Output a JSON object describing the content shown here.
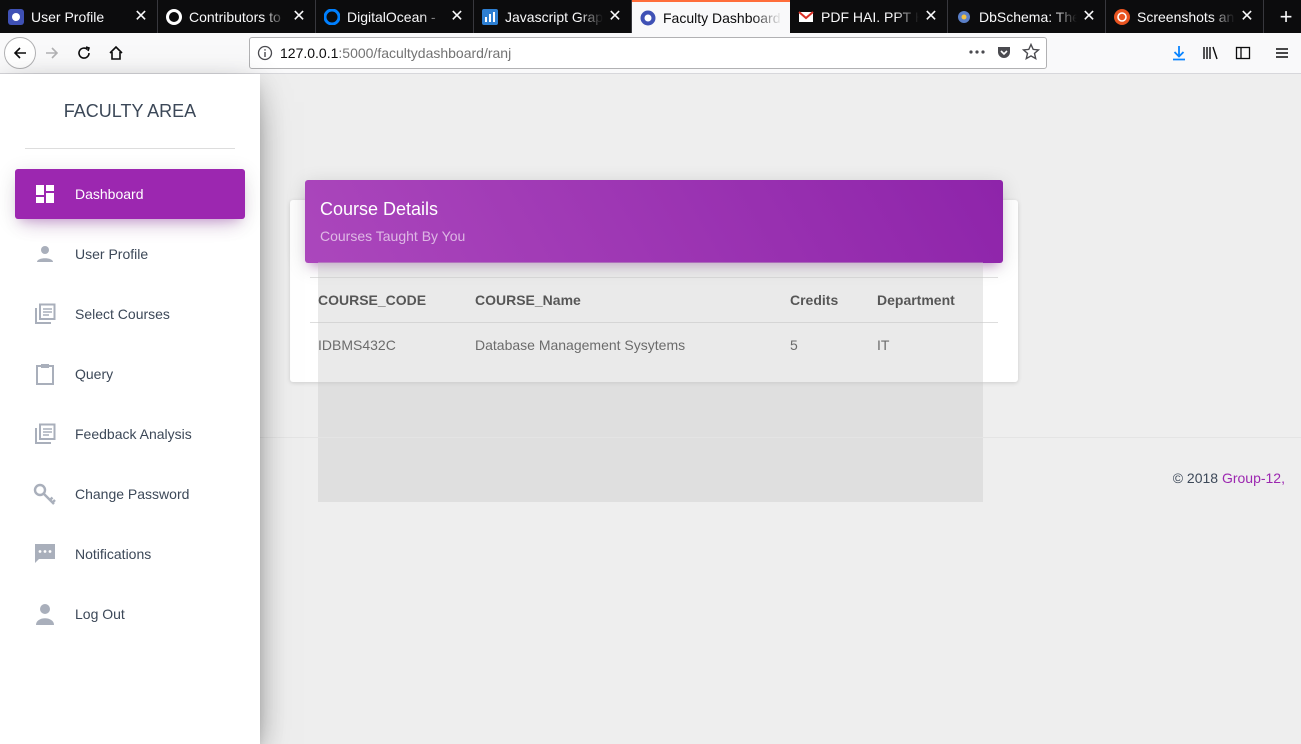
{
  "browser": {
    "tabs": [
      {
        "title": "User Profile",
        "icon": "profile-favicon",
        "active": false
      },
      {
        "title": "Contributors to",
        "icon": "github-favicon",
        "active": false
      },
      {
        "title": "DigitalOcean -",
        "icon": "digitalocean-favicon",
        "active": false
      },
      {
        "title": "Javascript Graph",
        "icon": "chart-favicon",
        "active": false
      },
      {
        "title": "Faculty Dashboard",
        "icon": "profile-favicon",
        "active": true
      },
      {
        "title": "PDF HAI. PPT HA",
        "icon": "gmail-favicon",
        "active": false
      },
      {
        "title": "DbSchema: The",
        "icon": "dbschema-favicon",
        "active": false
      },
      {
        "title": "Screenshots and",
        "icon": "ubuntu-favicon",
        "active": false
      }
    ],
    "url_host": "127.0.0.1",
    "url_rest": ":5000/facultydashboard/ranj",
    "accent_color": "#ff6d3a"
  },
  "sidebar": {
    "brand": "FACULTY AREA",
    "items": [
      {
        "label": "Dashboard",
        "icon": "dashboard-icon",
        "active": true
      },
      {
        "label": "User Profile",
        "icon": "person-icon",
        "active": false
      },
      {
        "label": "Select Courses",
        "icon": "library-books-icon",
        "active": false
      },
      {
        "label": "Query",
        "icon": "clipboard-icon",
        "active": false
      },
      {
        "label": "Feedback Analysis",
        "icon": "library-books-icon",
        "active": false
      },
      {
        "label": "Change Password",
        "icon": "key-icon",
        "active": false
      },
      {
        "label": "Notifications",
        "icon": "chat-bubble-icon",
        "active": false
      },
      {
        "label": "Log Out",
        "icon": "user-icon",
        "active": false
      }
    ],
    "active_color": "#9c27b0"
  },
  "card": {
    "title": "Course Details",
    "subtitle": "Courses Taught By You",
    "columns": [
      "COURSE_CODE",
      "COURSE_Name",
      "Credits",
      "Department"
    ],
    "rows": [
      [
        "IDBMS432C",
        "Database Management Sysytems",
        "5",
        "IT"
      ]
    ]
  },
  "footer": {
    "copyright_prefix": "© 2018",
    "copyright_link": "Group-12,"
  }
}
